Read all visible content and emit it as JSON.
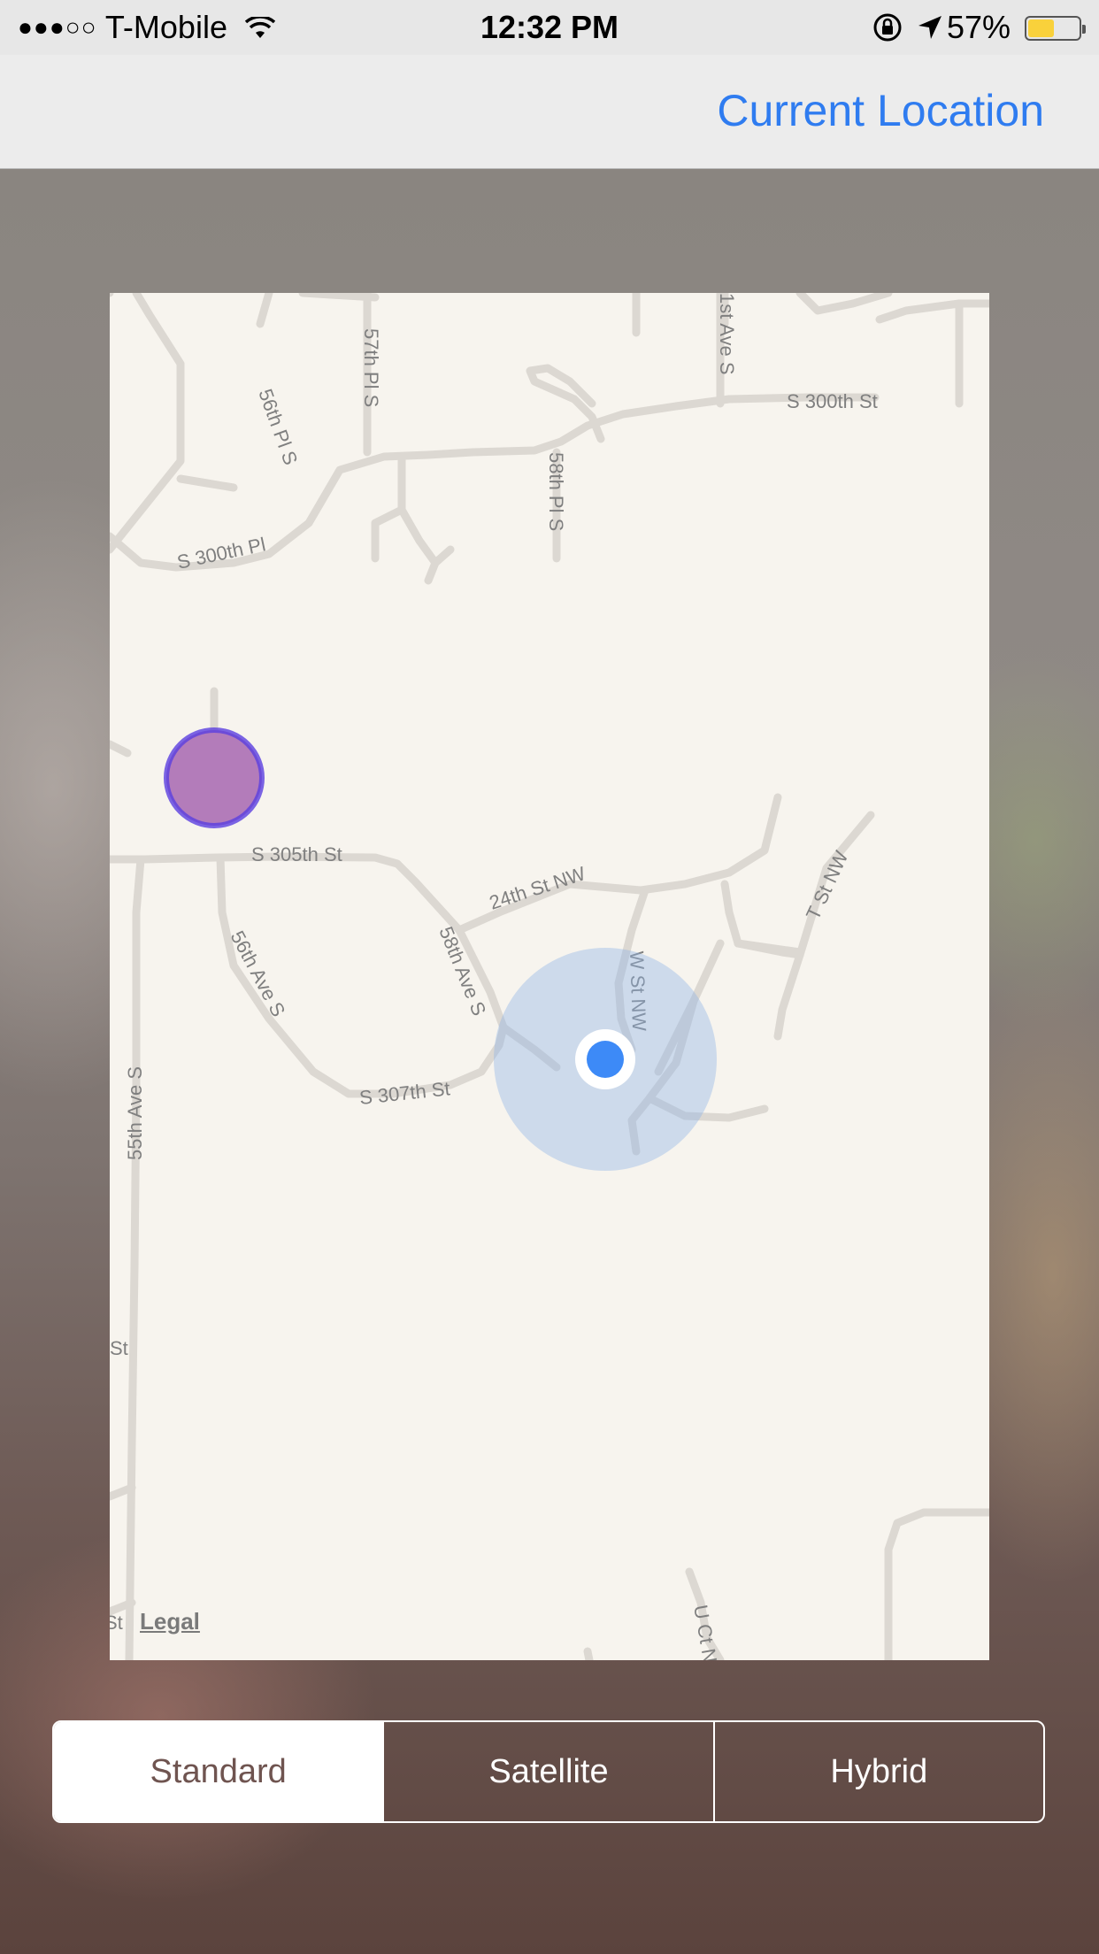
{
  "status_bar": {
    "signal_dots": "●●●○○",
    "carrier": "T-Mobile",
    "time": "12:32 PM",
    "battery_percent": "57%",
    "battery_level": 0.57
  },
  "nav": {
    "right_button": "Current Location"
  },
  "map": {
    "legal": "Legal",
    "labels": {
      "s300th_st": "S 300th St",
      "s300th_pl": "S 300th Pl",
      "fifty6th_pl_s": "56th Pl S",
      "fifty7th_pl_s": "57th Pl S",
      "fifty8th_pl_s": "58th Pl S",
      "first_ave_s": "1st Ave S",
      "s305th_st": "S 305th St",
      "twenty4th_st_nw": "24th St NW",
      "t_st_nw": "T St NW",
      "fifty6th_ave_s": "56th Ave S",
      "fifty8th_ave_s": "58th Ave S",
      "w_st_nw": "W St NW",
      "s307th_st": "S 307th St",
      "fifty5th_ave_s": "55th Ave S",
      "st_fragment": "St",
      "st_fragment_2": "St",
      "u_ct": "U Ct N"
    },
    "colors": {
      "background": "#f7f4ee",
      "road": "#dcd8d2",
      "user_dot": "#3d8af7",
      "accuracy_halo": "#c5d9f3",
      "pin_fill": "#b37cba",
      "pin_stroke": "#5a3fe0"
    }
  },
  "segmented_control": {
    "options": [
      "Standard",
      "Satellite",
      "Hybrid"
    ],
    "selected": "Standard"
  }
}
